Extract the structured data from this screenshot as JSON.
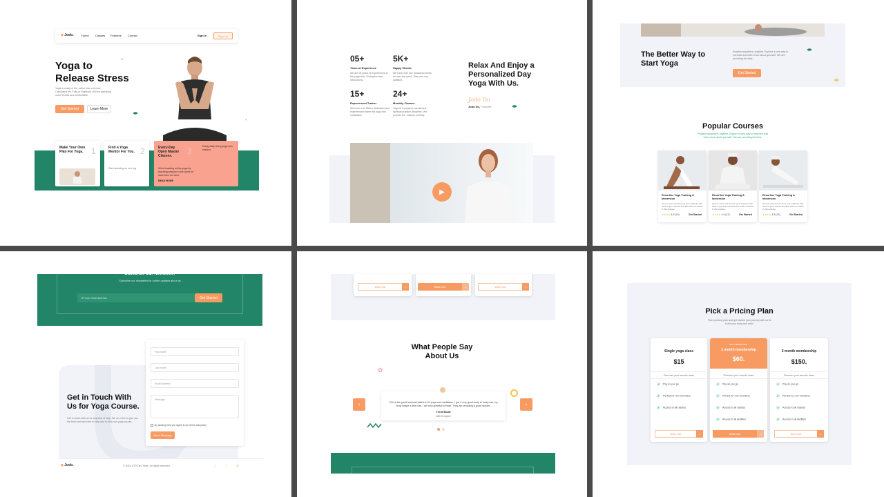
{
  "hero": {
    "logo": "Jodo.",
    "nav": [
      "Home",
      "Classes",
      "Features",
      "Contact"
    ],
    "signin": "Sign In",
    "signup": "Sign Up",
    "title_l1": "Yoga to",
    "title_l2": "Release Stress",
    "desc": "Yoga is a way of life, rather than a school. Calculated life. Fully of Gratitude. Will be practicing more flexible and comfortable.",
    "get_started": "Get Started",
    "learn_more": "Learn More",
    "steps": [
      {
        "title": "Make Your Own Plan For Yoga.",
        "num": "1"
      },
      {
        "title": "Find a Yoga Mentor For You.",
        "num": "2",
        "note": "Start standing on one leg"
      },
      {
        "title": "Every-Day Open Master Classes.",
        "num": "3",
        "note": "Doing daily doing yoga now session",
        "desc": "Were boasting online yoga by teaching session in the world for learn from the best.",
        "more": "READ MORE"
      }
    ]
  },
  "stats": {
    "items": [
      {
        "value": "05+",
        "label": "Years of Experience",
        "desc": "We are 05 years of experienced in the yoga field. Giving the best instructions."
      },
      {
        "value": "5K+",
        "label": "Happy Clients",
        "desc": "We have over five thousand clients all over the world. They are very satisfied."
      },
      {
        "value": "15+",
        "label": "Experienced Trainer",
        "desc": "We have over fifteen dedicated and experienced trainer for yoga and meditation."
      },
      {
        "value": "24+",
        "label": "Monthly Classes",
        "desc": "Yoga is a physical, mental and spiritual practice discipline. We provide 24+ classes monthly."
      }
    ],
    "headline_l1": "Relax And Enjoy a",
    "headline_l2": "Personalized Day",
    "headline_l3": "Yoga With Us.",
    "signature": "Jodo Do",
    "author": "Jodo Do,",
    "author_role": "Founder"
  },
  "courses": {
    "better_l1": "The Better Way to",
    "better_l2": "Start Yoga",
    "better_desc": "Practice anywhere, anytime. Explore a new way to exercise and learn more about yourself. We are providing the best.",
    "better_btn": "Get Started",
    "popular_title": "Popular Courses",
    "popular_sub": "Practice anywhere, anytime. Explore a new way to exercise and learn more about yourself. We are providing the best.",
    "cards": [
      {
        "title": "Resorline Yoga Training & Immersion",
        "desc": "Here is some text for how your students who want to get a stretch and also want to stretch in this posture.",
        "rating": "4.5",
        "reviews": "(10)",
        "action": "Get Started"
      },
      {
        "title": "Resorline Yoga Training & Immersion",
        "desc": "Here is some text for how your students who want to get a stretch and also want to stretch in this posture.",
        "rating": "4.5",
        "reviews": "(12)",
        "action": "Get Started"
      },
      {
        "title": "Resorline Yoga Training & Immersion",
        "desc": "Here is some text for how your students who want to get a stretch and also want to stretch in this posture.",
        "rating": "4.5",
        "reviews": "(13)",
        "action": "Get Started"
      }
    ]
  },
  "contact": {
    "newsletter_title": "Subscribe Our Newsletter",
    "newsletter_sub": "Subscribe our newsletter for further updates about us",
    "email_placeholder": "Your email address",
    "subscribe_btn": "Get Started",
    "title_l1": "Get in Touch With",
    "title_l2": "Us for Yoga Course.",
    "desc": "Get in touch with us for any kind of help. We are here to give you the best and also here to help you to find your yoga course.",
    "fields": [
      "First name",
      "Last name",
      "Email address",
      "Message"
    ],
    "agree": "By clicking here you agree to our terms and policy",
    "send": "Send Message",
    "footer_logo": "Jodo.",
    "copyright": "© 2022 UTD Dev Team. All rights reserved."
  },
  "testimonials": {
    "buy_now": "Book now",
    "title_l1": "What People Say",
    "title_l2": "About Us",
    "quote": "This is the great and best platform for yoga and meditation, I got a very good body at body now, my body shape is fine now. I am very greatful to those. They are providing a good service.",
    "name": "Trent Boult",
    "role": "Web Designer"
  },
  "pricing": {
    "title": "Pick a Pricing Plan",
    "sub": "Pick a pricing plan and get started your journey with us for build your body and mind.",
    "plans": [
      {
        "name": "Single yoga class",
        "price": "$15",
        "note": "Discover your favorite class",
        "features": [
          "Pay as you go",
          "Perfect for non-members",
          "Access to all classes"
        ],
        "cta": "Book now",
        "highlight": false
      },
      {
        "name": "1 month membership",
        "tag": "RECOMMENDED",
        "price": "$60.",
        "note": "Discover your favorite class",
        "features": [
          "Pay as you go",
          "Perfect for non-members",
          "Access to all classes",
          "Access to all facilities"
        ],
        "cta": "Book now",
        "highlight": true
      },
      {
        "name": "3 month membership",
        "price": "$150.",
        "note": "Discover your favorite class",
        "features": [
          "Pay as you go",
          "Perfect for non-members",
          "Access to all classes",
          "Access to all facilities"
        ],
        "cta": "Book now",
        "highlight": false
      }
    ]
  },
  "colors": {
    "accent": "#f79b63",
    "teal": "#238567",
    "salmon": "#f9a28f",
    "separator": "#4a4a4a"
  }
}
